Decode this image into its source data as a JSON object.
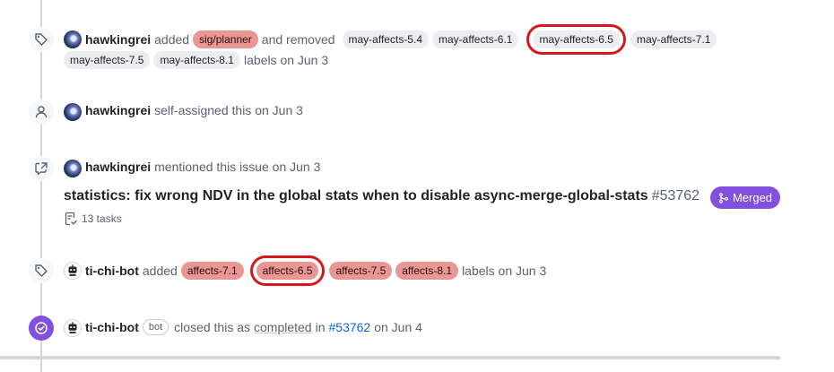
{
  "event1": {
    "author": "hawkingrei",
    "text_added": "added",
    "added_label": "sig/planner",
    "text_removed": "and removed",
    "removed_labels": [
      "may-affects-5.4",
      "may-affects-6.1",
      "may-affects-6.5",
      "may-affects-7.1",
      "may-affects-7.5",
      "may-affects-8.1"
    ],
    "suffix": "labels on Jun 3"
  },
  "event2": {
    "author": "hawkingrei",
    "text": "self-assigned this on Jun 3"
  },
  "event3": {
    "author": "hawkingrei",
    "text": "mentioned this issue on Jun 3",
    "issue_title": "statistics: fix wrong NDV in the global stats when to disable async-merge-global-stats",
    "issue_number": "#53762",
    "tasks": "13 tasks",
    "status": "Merged"
  },
  "event4": {
    "author": "ti-chi-bot",
    "text_added": "added",
    "labels": [
      "affects-7.1",
      "affects-6.5",
      "affects-7.5",
      "affects-8.1"
    ],
    "suffix": "labels on Jun 3"
  },
  "event5": {
    "author": "ti-chi-bot",
    "bot_tag": "bot",
    "text1": "closed this as",
    "link_completed": "completed",
    "text_in": "in",
    "pr_link": "#53762",
    "suffix": "on Jun 4"
  },
  "colors": {
    "label_grey": "#ebedf0",
    "label_red": "#e99695",
    "merged_purple": "#8250df",
    "highlight_red": "#d8161b",
    "link_blue": "#0969da"
  }
}
